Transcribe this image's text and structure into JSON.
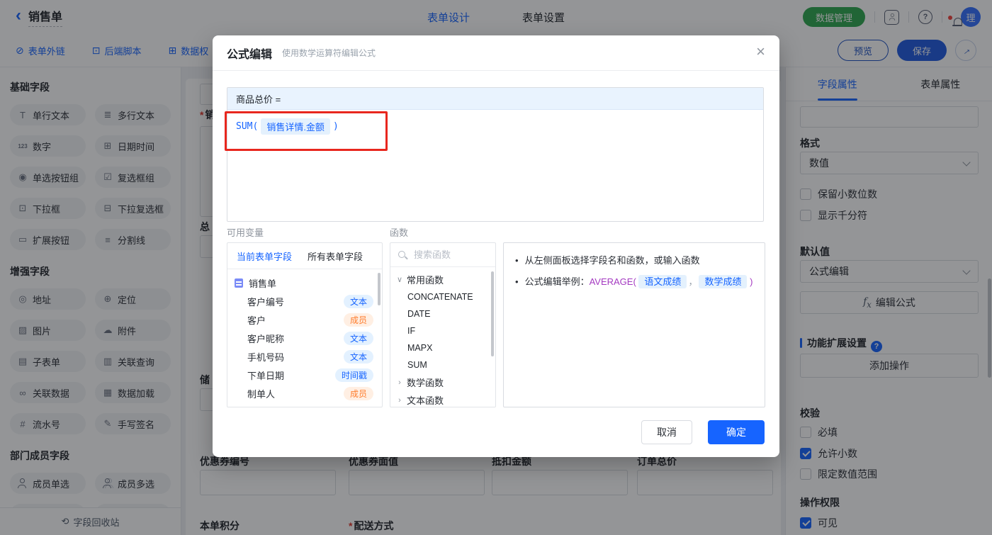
{
  "topbar": {
    "title": "销售单",
    "tabs": [
      {
        "label": "表单设计"
      },
      {
        "label": "表单设置"
      }
    ],
    "data_manage_label": "数据管理",
    "avatar_text": "理"
  },
  "toolbar": {
    "links": [
      {
        "label": "表单外链"
      },
      {
        "label": "后端脚本"
      },
      {
        "label": "数据权"
      }
    ],
    "preview_label": "预览",
    "save_label": "保存"
  },
  "left_sidebar": {
    "sections": [
      {
        "title": "基础字段",
        "items": [
          {
            "icon": "single-line-text-icon",
            "label": "单行文本"
          },
          {
            "icon": "multi-line-text-icon",
            "label": "多行文本"
          },
          {
            "icon": "number-icon",
            "label": "数字"
          },
          {
            "icon": "datetime-icon",
            "label": "日期时间"
          },
          {
            "icon": "radio-group-icon",
            "label": "单选按钮组"
          },
          {
            "icon": "checkbox-group-icon",
            "label": "复选框组"
          },
          {
            "icon": "select-icon",
            "label": "下拉框"
          },
          {
            "icon": "multi-select-icon",
            "label": "下拉复选框"
          },
          {
            "icon": "extend-button-icon",
            "label": "扩展按钮"
          },
          {
            "icon": "divider-icon",
            "label": "分割线"
          }
        ]
      },
      {
        "title": "增强字段",
        "items": [
          {
            "icon": "address-icon",
            "label": "地址"
          },
          {
            "icon": "location-icon",
            "label": "定位"
          },
          {
            "icon": "image-icon",
            "label": "图片"
          },
          {
            "icon": "attachment-icon",
            "label": "附件"
          },
          {
            "icon": "subform-icon",
            "label": "子表单"
          },
          {
            "icon": "linked-query-icon",
            "label": "关联查询"
          },
          {
            "icon": "linked-data-icon",
            "label": "关联数据"
          },
          {
            "icon": "data-load-icon",
            "label": "数据加载"
          },
          {
            "icon": "serial-number-icon",
            "label": "流水号"
          },
          {
            "icon": "signature-icon",
            "label": "手写签名"
          }
        ]
      },
      {
        "title": "部门成员字段",
        "items": [
          {
            "icon": "member-single-icon",
            "label": "成员单选"
          },
          {
            "icon": "member-multi-icon",
            "label": "成员多选"
          }
        ]
      }
    ],
    "footer_label": "字段回收站"
  },
  "canvas": {
    "partial_labels": [
      {
        "text": "销",
        "required": true
      },
      {
        "text": "总",
        "required": false
      },
      {
        "text": "储",
        "required": false
      }
    ],
    "row1_labels": [
      "优惠券编号",
      "优惠券面值",
      "抵扣金额",
      "订单总价"
    ],
    "row2_labels": [
      {
        "text": "本单积分",
        "required": false
      },
      {
        "text": "配送方式",
        "required": true
      }
    ]
  },
  "modal": {
    "title": "公式编辑",
    "subtitle": "使用数学运算符编辑公式",
    "formula": {
      "target": "商品总价 =",
      "function_name": "SUM(",
      "token": "销售详情.金额",
      "closing": ")"
    },
    "variables": {
      "label": "可用变量",
      "tabs": [
        {
          "label": "当前表单字段"
        },
        {
          "label": "所有表单字段"
        }
      ],
      "root": "销售单",
      "fields": [
        {
          "name": "客户编号",
          "type": "文本"
        },
        {
          "name": "客户",
          "type": "成员"
        },
        {
          "name": "客户昵称",
          "type": "文本"
        },
        {
          "name": "手机号码",
          "type": "文本"
        },
        {
          "name": "下单日期",
          "type": "时间戳"
        },
        {
          "name": "制单人",
          "type": "成员"
        }
      ]
    },
    "functions": {
      "label": "函数",
      "search_placeholder": "搜索函数",
      "groups": [
        {
          "name": "常用函数",
          "items": [
            "CONCATENATE",
            "DATE",
            "IF",
            "MAPX",
            "SUM"
          ]
        },
        {
          "name": "数学函数",
          "items": []
        },
        {
          "name": "文本函数",
          "items": []
        }
      ]
    },
    "help": {
      "line1": "从左侧面板选择字段名和函数，或输入函数",
      "example_prefix": "公式编辑举例：",
      "example_function": "AVERAGE(",
      "example_token1": "语文成绩",
      "example_separator": "，",
      "example_token2": "数学成绩",
      "example_closing": ")"
    },
    "cancel_label": "取消",
    "confirm_label": "确定"
  },
  "right_panel": {
    "tabs": [
      {
        "label": "字段属性"
      },
      {
        "label": "表单属性"
      }
    ],
    "format": {
      "label": "格式",
      "value": "数值"
    },
    "format_options": [
      {
        "label": "保留小数位数",
        "checked": false
      },
      {
        "label": "显示千分符",
        "checked": false
      }
    ],
    "default_value": {
      "label": "默认值",
      "value": "公式编辑",
      "edit_button_label": "编辑公式"
    },
    "extension": {
      "label": "功能扩展设置",
      "button_label": "添加操作"
    },
    "validation": {
      "label": "校验",
      "items": [
        {
          "label": "必填",
          "checked": false
        },
        {
          "label": "允许小数",
          "checked": true
        },
        {
          "label": "限定数值范围",
          "checked": false
        }
      ]
    },
    "permission": {
      "label": "操作权限",
      "items": [
        {
          "label": "可见",
          "checked": true
        }
      ]
    }
  },
  "colors": {
    "primary_blue": "#1664ff",
    "brand_green": "#2fa84f",
    "save_blue": "#1f5ae0",
    "annotation_red": "#e8271e",
    "badge_blue_text": "#1664ff",
    "badge_orange_text": "#ff7d2e",
    "function_purple": "#a43ac1"
  }
}
